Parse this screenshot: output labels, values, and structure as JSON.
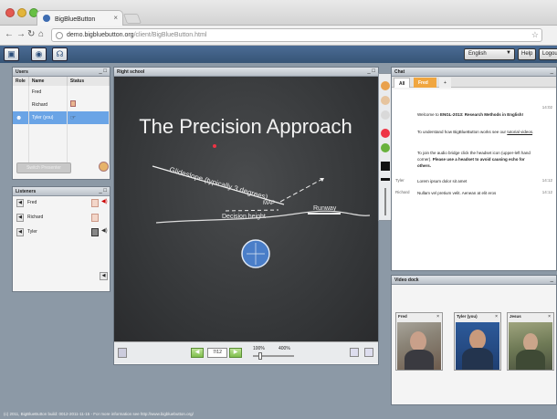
{
  "browser": {
    "tab_title": "BigBlueButton",
    "url_host": "demo.bigbluebutton.org",
    "url_path": "/client/BigBlueButton.html"
  },
  "toolbar": {
    "language": "English",
    "help": "Help",
    "logout": "Logout"
  },
  "users": {
    "title": "Users",
    "col_role": "Role",
    "col_name": "Name",
    "col_status": "Status",
    "rows": [
      {
        "name": "Fred"
      },
      {
        "name": "Richard"
      },
      {
        "name": "Tyler (you)"
      }
    ],
    "action_button": "Switch Presenter"
  },
  "listeners": {
    "title": "Listeners",
    "rows": [
      "Fred",
      "Richard",
      "Tyler"
    ]
  },
  "presentation": {
    "title": "Right school",
    "slide_title": "The Precision Approach",
    "labels": {
      "glideslope": "Glideslope (typically 3 degrees)",
      "map": "MAP",
      "runway": "Runway",
      "decision": "Decision height"
    },
    "page": "7/12",
    "zoom_min": "100%",
    "zoom_max": "400%"
  },
  "chat": {
    "title": "Chat",
    "tabs": [
      "All",
      "Fred",
      "+"
    ],
    "welcome_time": "14:02",
    "welcome_1_pre": "Welcome to ",
    "welcome_1_bold": "ENGL-2013: Research Methods in English!",
    "welcome_2_pre": "To understand how BigBlueButton works see our ",
    "welcome_2_link": "tutorial videos",
    "welcome_2_post": ".",
    "welcome_3": "To join the audio bridge click the headset icon (upper-left hand corner). ",
    "welcome_3_bold": "Please use a headset to avoid causing echo for others.",
    "messages": [
      {
        "name": "Tyler",
        "text": "Lorem ipsum dolor sit amet",
        "time": "14:12"
      },
      {
        "name": "Richard",
        "text": "Nullam vel pretium velit. Aenean at elit eros",
        "time": "14:12"
      }
    ]
  },
  "video_dock": {
    "title": "Video dock",
    "cams": [
      "Fred",
      "Tyler (you)",
      "Jesus"
    ]
  },
  "footer": "(c) 2011, BigBlueButton build: 0012-2011-11-15 - For more information see http://www.bigbluebutton.org/"
}
